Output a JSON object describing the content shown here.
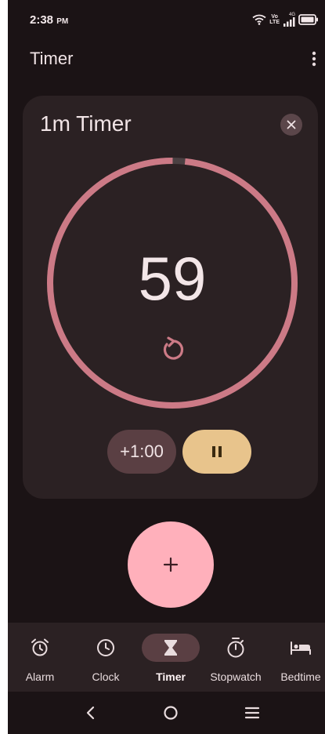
{
  "status_bar": {
    "time": "2:38",
    "ampm": "PM",
    "volte_top": "Vo",
    "volte_bottom": "LTE",
    "network_label": "4G"
  },
  "app_bar": {
    "title": "Timer",
    "more_icon": "more-vert-icon"
  },
  "timer_card": {
    "title": "1m Timer",
    "remaining": "59",
    "progress_elapsed_fraction": 0.0167,
    "add_minute_label": "+1:00",
    "icons": {
      "close": "close-icon",
      "reset": "reset-icon",
      "pause": "pause-icon"
    }
  },
  "fab": {
    "icon": "add-icon"
  },
  "bottom_nav": {
    "items": [
      {
        "label": "Alarm",
        "icon": "alarm-icon",
        "active": false
      },
      {
        "label": "Clock",
        "icon": "clock-icon",
        "active": false
      },
      {
        "label": "Timer",
        "icon": "hourglass-icon",
        "active": true
      },
      {
        "label": "Stopwatch",
        "icon": "stopwatch-icon",
        "active": false
      },
      {
        "label": "Bedtime",
        "icon": "bed-icon",
        "active": false
      }
    ]
  },
  "system_nav": {
    "back": "back-icon",
    "home": "home-icon",
    "recents": "recents-icon"
  },
  "colors": {
    "background": "#1b1315",
    "card": "#2b2123",
    "ring": "#cc7a86",
    "ring_track": "#4a4042",
    "pause_button": "#e8c48c",
    "fab": "#ffb0bb",
    "active_pill": "#5a3f43"
  }
}
